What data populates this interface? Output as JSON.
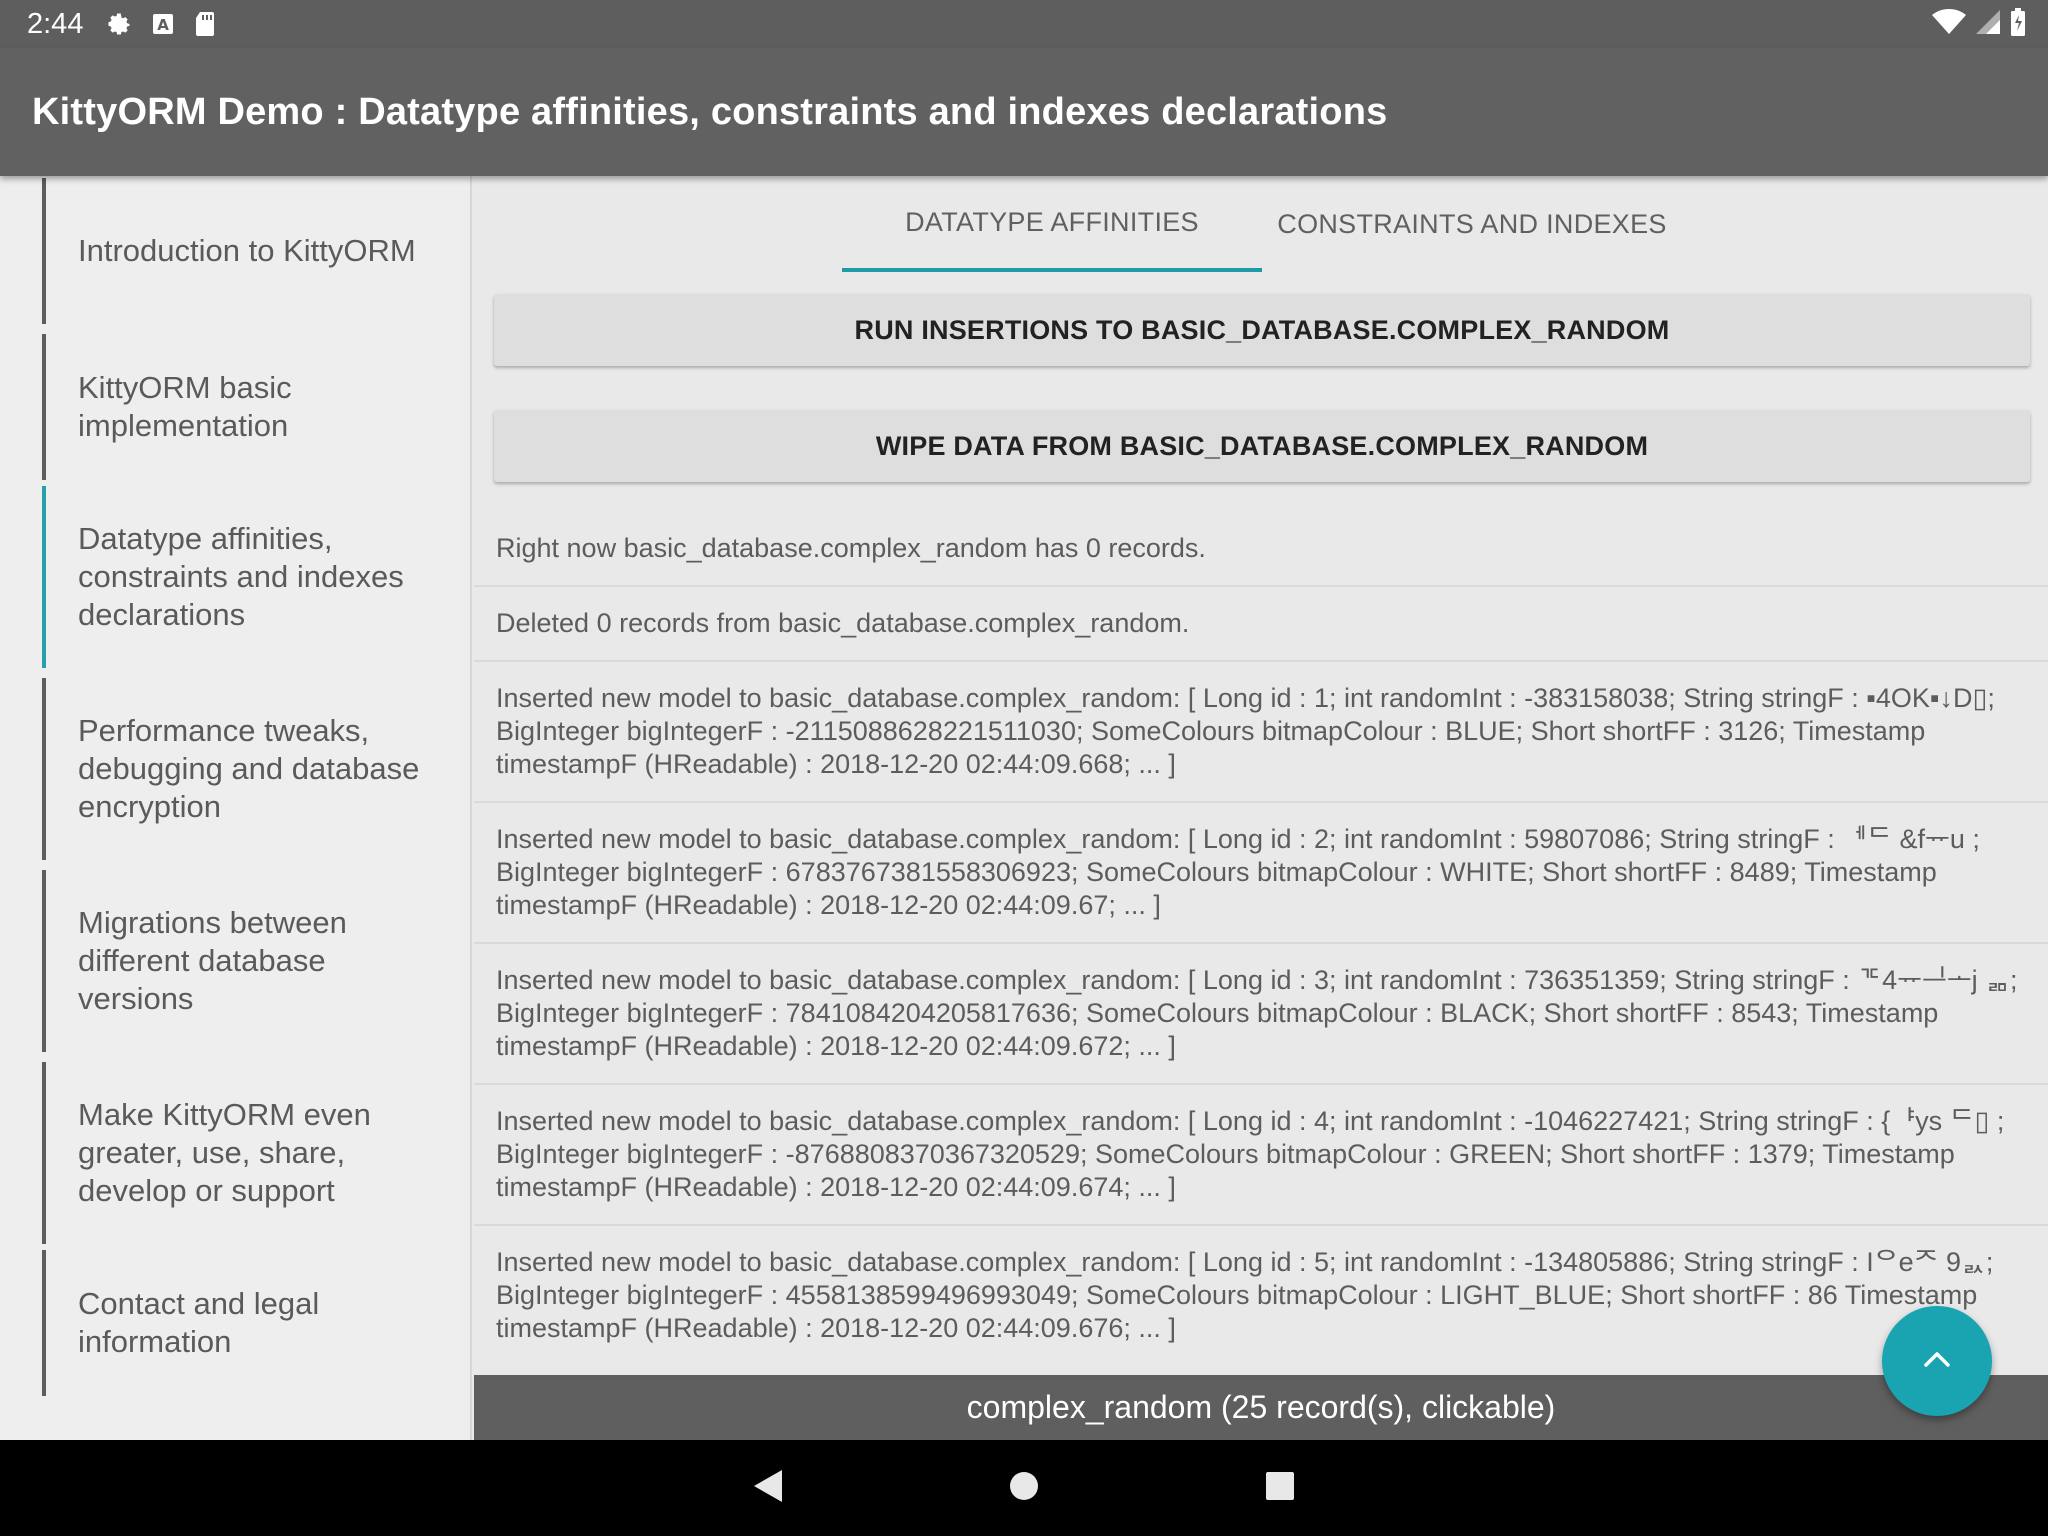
{
  "status_bar": {
    "time": "2:44",
    "icons_left": [
      "gear-icon",
      "a-icon",
      "sdcard-icon"
    ],
    "icons_right": [
      "wifi-icon",
      "signal-icon",
      "battery-icon"
    ]
  },
  "app_bar": {
    "title": "KittyORM Demo : Datatype affinities, constraints and indexes declarations"
  },
  "sidebar": {
    "items": [
      {
        "label": "Introduction to KittyORM",
        "active": false
      },
      {
        "label": "KittyORM basic implementation",
        "active": false
      },
      {
        "label": "Datatype affinities, constraints and indexes declarations",
        "active": true
      },
      {
        "label": "Performance tweaks, debugging and database encryption",
        "active": false
      },
      {
        "label": "Migrations between different database versions",
        "active": false
      },
      {
        "label": "Make KittyORM even greater, use, share, develop or support",
        "active": false
      },
      {
        "label": "Contact and legal information",
        "active": false
      }
    ]
  },
  "tabs": [
    {
      "label": "DATATYPE AFFINITIES",
      "active": true
    },
    {
      "label": "CONSTRAINTS AND INDEXES",
      "active": false
    }
  ],
  "buttons": {
    "run": "RUN INSERTIONS TO BASIC_DATABASE.COMPLEX_RANDOM",
    "wipe": "WIPE DATA FROM BASIC_DATABASE.COMPLEX_RANDOM"
  },
  "log": [
    "Right now basic_database.complex_random has 0 records.",
    "Deleted 0 records from basic_database.complex_random.",
    "Inserted new model to basic_database.complex_random: [ Long id : 1; int randomInt : -383158038; String stringF : ▪4OK▪↓D▯; BigInteger bigIntegerF : -2115088628221511030; SomeColours bitmapColour : BLUE; Short shortFF : 3126; Timestamp timestampF (HReadable) : 2018-12-20 02:44:09.668; ... ]",
    "Inserted new model to basic_database.complex_random: [ Long id : 2; int randomInt : 59807086; String stringF : ᅦᄃ &fᅲu ; BigInteger bigIntegerF : 6783767381558306923; SomeColours bitmapColour : WHITE; Short shortFF : 8489; Timestamp timestampF (HReadable) : 2018-12-20 02:44:09.67; ... ]",
    "Inserted new model to basic_database.complex_random: [ Long id : 3; int randomInt : 736351359; String stringF : ᄀᄃ4ᅲᆜᅩj ᆱ; BigInteger bigIntegerF : 7841084204205817636; SomeColours bitmapColour : BLACK; Short shortFF : 8543; Timestamp timestampF (HReadable) : 2018-12-20 02:44:09.672; ... ]",
    "Inserted new model to basic_database.complex_random: [ Long id : 4; int randomInt : -1046227421; String stringF : {ᅣys ᄃ▯ ; BigInteger bigIntegerF : -8768808370367320529; SomeColours bitmapColour : GREEN; Short shortFF : 1379; Timestamp timestampF (HReadable) : 2018-12-20 02:44:09.674; ... ]",
    "Inserted new model to basic_database.complex_random: [ Long id : 5; int randomInt : -134805886; String stringF : Iᄋeᄌ 9ᆳ; BigInteger bigIntegerF : 4558138599496993049; SomeColours bitmapColour : LIGHT_BLUE; Short shortFF : 86 Timestamp timestampF (HReadable) : 2018-12-20 02:44:09.676; ... ]"
  ],
  "footer": {
    "label": "complex_random (25 record(s), clickable)"
  },
  "fab": {
    "icon": "chevron-up-icon"
  },
  "colors": {
    "accent": "#1aa3b0",
    "app_bar": "#616161",
    "status_bar": "#5e5e5e"
  }
}
